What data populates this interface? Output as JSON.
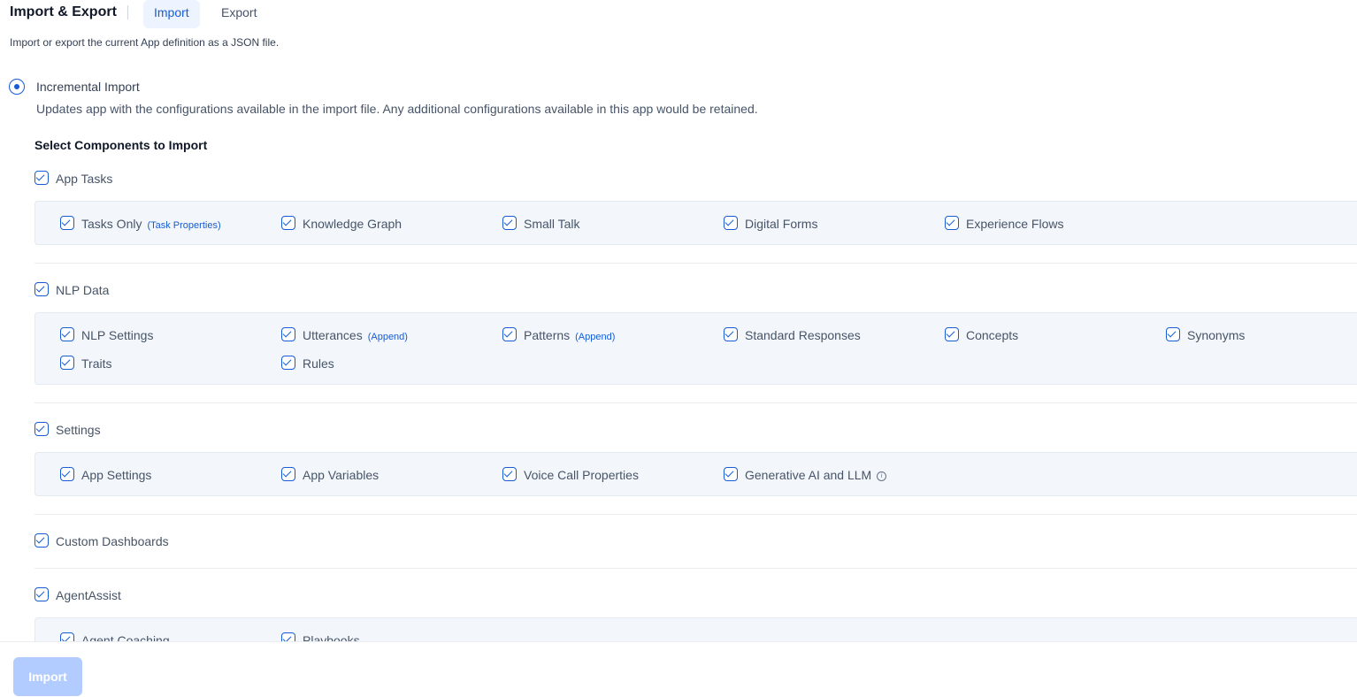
{
  "header": {
    "title": "Import & Export",
    "tabs": [
      {
        "label": "Import",
        "active": true
      },
      {
        "label": "Export",
        "active": false
      }
    ],
    "subtitle": "Import or export the current App definition as a JSON file."
  },
  "import_mode": {
    "label": "Incremental Import",
    "selected": true,
    "description": "Updates app with the configurations available in the import file. Any additional configurations available in this app would be retained."
  },
  "components_title": "Select Components to Import",
  "groups": {
    "app_tasks": {
      "label": "App Tasks",
      "items": [
        {
          "label": "Tasks Only",
          "hint": "(Task Properties)"
        },
        {
          "label": "Knowledge Graph"
        },
        {
          "label": "Small Talk"
        },
        {
          "label": "Digital Forms"
        },
        {
          "label": "Experience Flows"
        }
      ]
    },
    "nlp_data": {
      "label": "NLP Data",
      "items": [
        {
          "label": "NLP Settings"
        },
        {
          "label": "Utterances",
          "hint": "(Append)"
        },
        {
          "label": "Patterns",
          "hint": "(Append)"
        },
        {
          "label": "Standard Responses"
        },
        {
          "label": "Concepts"
        },
        {
          "label": "Synonyms"
        },
        {
          "label": "Traits"
        },
        {
          "label": "Rules"
        }
      ]
    },
    "settings": {
      "label": "Settings",
      "items": [
        {
          "label": "App Settings"
        },
        {
          "label": "App Variables"
        },
        {
          "label": "Voice Call Properties"
        },
        {
          "label": "Generative AI and LLM",
          "info_icon": "info-icon"
        }
      ]
    },
    "custom_dashboards": {
      "label": "Custom Dashboards"
    },
    "agent_assist": {
      "label": "AgentAssist",
      "items": [
        {
          "label": "Agent Coaching"
        },
        {
          "label": "Playbooks"
        }
      ]
    }
  },
  "footer": {
    "import_label": "Import"
  },
  "colors": {
    "accent": "#175cd3",
    "panel_bg": "#f3f7fc",
    "disabled_button": "#b2ccff"
  }
}
